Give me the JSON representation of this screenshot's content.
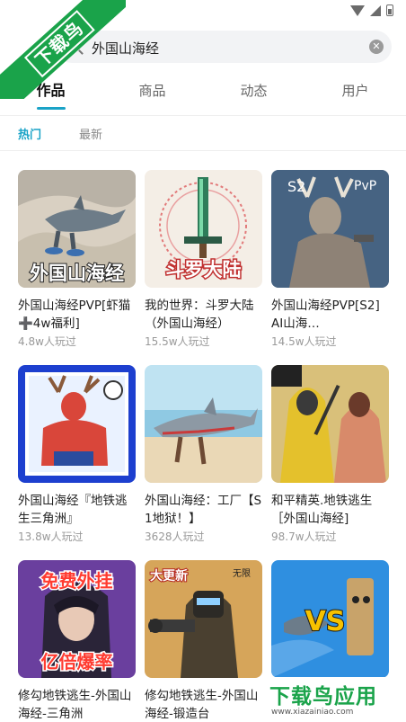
{
  "status": {
    "icons": [
      "wifi-icon",
      "signal-icon",
      "battery-icon"
    ]
  },
  "watermark": {
    "corner_text": "下载鸟",
    "brand": "下载鸟应用",
    "url": "www.xiazainiao.com"
  },
  "search": {
    "query": "外国山海经",
    "clear_icon": "clear-icon",
    "search_icon": "search-icon"
  },
  "tabs": [
    {
      "label": "作品",
      "active": true
    },
    {
      "label": "商品",
      "active": false
    },
    {
      "label": "动态",
      "active": false
    },
    {
      "label": "用户",
      "active": false
    }
  ],
  "subtabs": [
    {
      "label": "热门",
      "active": true
    },
    {
      "label": "最新",
      "active": false
    }
  ],
  "accent_color": "#1aa3c7",
  "brand_color": "#1aa34a",
  "cards": [
    {
      "title": "外国山海经PVP[虾猫➕4w福利]",
      "plays": "4.8w人玩过",
      "thumb_text": "外国山海经"
    },
    {
      "title": "我的世界：斗罗大陆（外国山海经）",
      "plays": "15.5w人玩过",
      "thumb_text": "斗罗大陆"
    },
    {
      "title": "外国山海经PVP[S2] AI山海…",
      "plays": "14.5w人玩过",
      "thumb_text_left": "S2",
      "thumb_text_right": "PvP"
    },
    {
      "title": "外国山海经『地铁逃生三角洲』",
      "plays": "13.8w人玩过"
    },
    {
      "title": "外国山海经：工厂【S1地狱！】",
      "plays": "3628人玩过"
    },
    {
      "title": "和平精英.地铁逃生［外国山海经]",
      "plays": "98.7w人玩过"
    },
    {
      "title": "修勾地铁逃生-外国山海经-三角洲",
      "plays": "",
      "thumb_text_top": "免费外挂",
      "thumb_text_bottom": "亿倍爆率"
    },
    {
      "title": "修勾地铁逃生-外国山海经-锻造台",
      "plays": "",
      "thumb_text_left": "大更新",
      "thumb_text_right": "无限"
    },
    {
      "title": "",
      "plays": "",
      "thumb_text": "VS"
    }
  ]
}
